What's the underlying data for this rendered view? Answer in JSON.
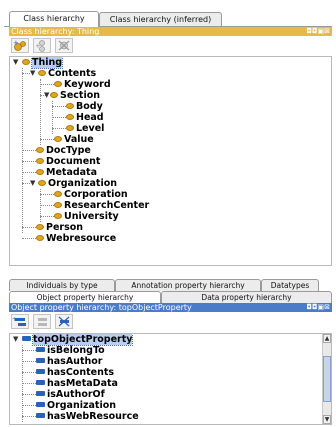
{
  "class_view": {
    "tabs": [
      {
        "label": "Class hierarchy",
        "active": true
      },
      {
        "label": "Class hierarchy (inferred)",
        "active": false
      }
    ],
    "header_title": "Class hierarchy: Thing",
    "header_controls": "◘◘▣⊠",
    "toolbar": {
      "add_subclass_icon": "add-subclass-icon",
      "add_sibling_icon": "add-sibling-icon",
      "delete_icon": "delete-class-icon"
    },
    "tree": {
      "root": "Thing",
      "contents": "Contents",
      "keyword": "Keyword",
      "section": "Section",
      "body": "Body",
      "head": "Head",
      "level": "Level",
      "value": "Value",
      "doctype": "DocType",
      "document": "Document",
      "metadata": "Metadata",
      "organization": "Organization",
      "corporation": "Corporation",
      "researchcenter": "ResearchCenter",
      "university": "University",
      "person": "Person",
      "webresource": "Webresource"
    },
    "colors": {
      "header": "#e6b94a",
      "bullet": "#e0a620"
    }
  },
  "property_view": {
    "tabs_row1": [
      {
        "label": "Individuals by type"
      },
      {
        "label": "Annotation property hierarchy"
      },
      {
        "label": "Datatypes"
      }
    ],
    "tabs_row2": [
      {
        "label": "Object property hierarchy",
        "active": true
      },
      {
        "label": "Data property hierarchy",
        "active": false
      }
    ],
    "header_title": "Object property hierarchy: topObjectProperty",
    "header_controls": "◘◘▣⊠",
    "tree": {
      "root": "topObjectProperty",
      "items": [
        "isBelongTo",
        "hasAuthor",
        "hasContents",
        "hasMetaData",
        "isAuthorOf",
        "Organization",
        "hasWebResource"
      ]
    },
    "colors": {
      "header": "#4a7cc8",
      "prop": "#2a62b8"
    }
  }
}
